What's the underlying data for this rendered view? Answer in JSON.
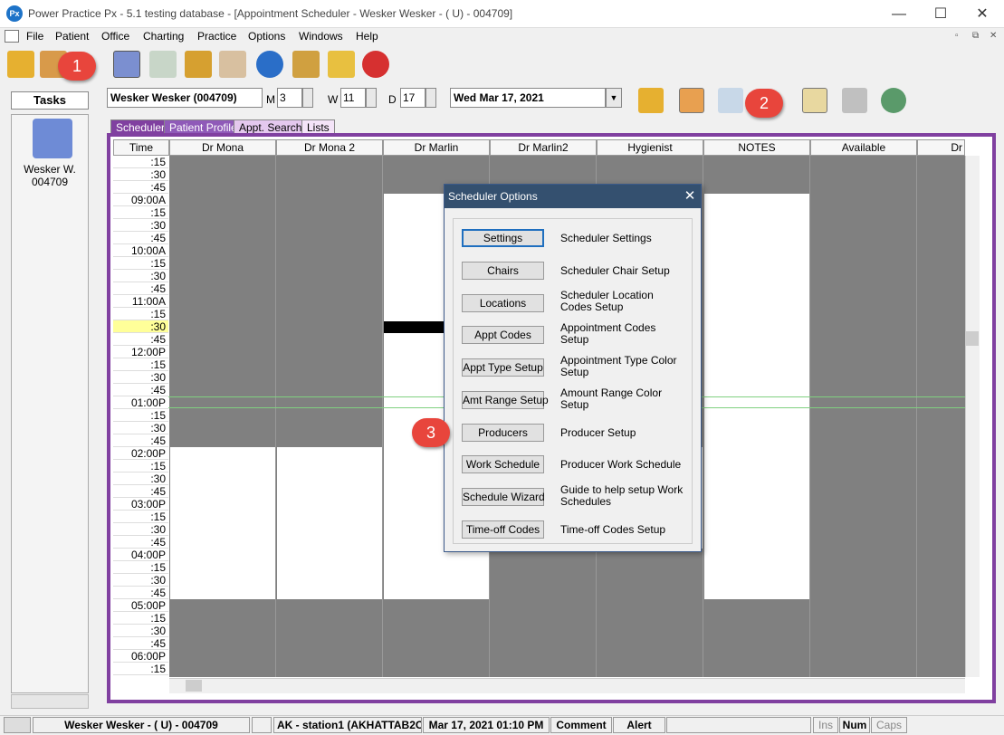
{
  "window": {
    "app_icon_text": "Px",
    "title": "Power Practice Px - 5.1 testing database - [Appointment Scheduler - Wesker Wesker - ( U) - 004709]",
    "minimize": "—",
    "maximize": "☐",
    "close": "✕"
  },
  "menu": {
    "items": [
      "File",
      "Patient",
      "Office",
      "Charting",
      "Practice",
      "Options",
      "Windows",
      "Help"
    ],
    "mdi_buttons": [
      "▫",
      "⧉",
      "✕"
    ]
  },
  "toolbar": {
    "icons": [
      "open-folder-icon",
      "patients-icon",
      "scheduler-book-icon",
      "chart-notes-icon",
      "package-icon",
      "calendar-grid-icon",
      "info-icon",
      "documents-icon",
      "folder-icon",
      "close-red-icon"
    ]
  },
  "tasks": {
    "header": "Tasks",
    "patient_name": "Wesker W.",
    "patient_id": "004709"
  },
  "patient_bar": {
    "patient_combo": "Wesker Wesker (004709)",
    "m_label": "M",
    "m_value": "3",
    "w_label": "W",
    "w_value": "11",
    "d_label": "D",
    "d_value": "17",
    "date": "Wed  Mar 17, 2021"
  },
  "tabs": [
    "Scheduler",
    "Patient Profile",
    "Appt. Search",
    "Lists"
  ],
  "columns": [
    "Time",
    "Dr Mona",
    "Dr Mona 2",
    "Dr Marlin",
    "Dr Marlin2",
    "Hygienist",
    "NOTES",
    "Available",
    "Dr"
  ],
  "times": [
    ":15",
    ":30",
    ":45",
    "09:00A",
    ":15",
    ":30",
    ":45",
    "10:00A",
    ":15",
    ":30",
    ":45",
    "11:00A",
    ":15",
    ":30",
    ":45",
    "12:00P",
    ":15",
    ":30",
    ":45",
    "01:00P",
    ":15",
    ":30",
    ":45",
    "02:00P",
    ":15",
    ":30",
    ":45",
    "03:00P",
    ":15",
    ":30",
    ":45",
    "04:00P",
    ":15",
    ":30",
    ":45",
    "05:00P",
    ":15",
    ":30",
    ":45",
    "06:00P",
    ":15"
  ],
  "dialog": {
    "title": "Scheduler Options",
    "close": "✕",
    "options": [
      {
        "button": "Settings",
        "desc": "Scheduler Settings"
      },
      {
        "button": "Chairs",
        "desc": "Scheduler Chair Setup"
      },
      {
        "button": "Locations",
        "desc": "Scheduler Location Codes Setup"
      },
      {
        "button": "Appt Codes",
        "desc": "Appointment Codes Setup"
      },
      {
        "button": "Appt Type Setup",
        "desc": "Appointment Type Color Setup"
      },
      {
        "button": "Amt Range Setup",
        "desc": "Amount Range Color Setup"
      },
      {
        "button": "Producers",
        "desc": "Producer Setup"
      },
      {
        "button": "Work Schedule",
        "desc": "Producer Work Schedule"
      },
      {
        "button": "Schedule Wizard",
        "desc": "Guide to help setup Work Schedules"
      },
      {
        "button": "Time-off Codes",
        "desc": "Time-off Codes Setup"
      }
    ]
  },
  "callouts": [
    "1",
    "2",
    "3"
  ],
  "status": {
    "patient": "Wesker Wesker - ( U) - 004709",
    "station": "AK - station1 (AKHATTAB2C",
    "datetime": "Mar 17, 2021 01:10 PM",
    "comment": "Comment",
    "alert": "Alert",
    "ins": "Ins",
    "num": "Num",
    "caps": "Caps"
  },
  "colors": {
    "accent_purple": "#8040a0",
    "grid_gray": "#808080",
    "dialog_title": "#34506f",
    "callout_red": "#e8453c",
    "current_slot": "#ffff99"
  }
}
